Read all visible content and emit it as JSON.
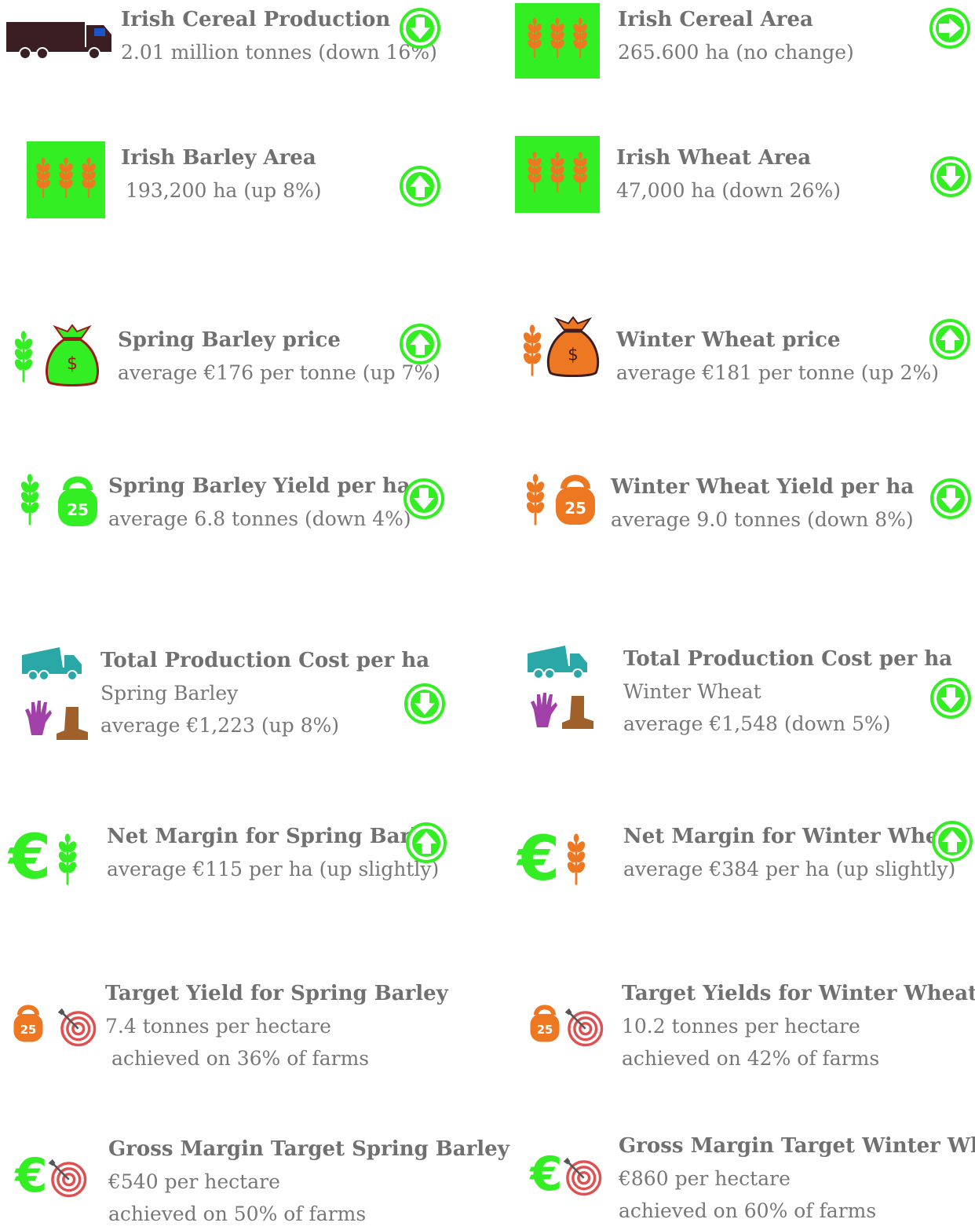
{
  "colors": {
    "green": "#33ee22",
    "orange": "#ee7722",
    "teal": "#2aa8a8",
    "purple": "#a040a8",
    "brown": "#a0602a",
    "truck": "#3a1e22",
    "target_red": "#e05050",
    "text_title": "#707070",
    "text_body": "#777777"
  },
  "items": [
    {
      "title": "Irish Cereal Production",
      "lines": [
        "2.01 million tonnes (down 16%)"
      ],
      "trend": "down",
      "icons": [
        "truck-icon"
      ]
    },
    {
      "title": "Irish Cereal Area",
      "lines": [
        "265.600 ha (no change)"
      ],
      "trend": "right",
      "icons": [
        "wheat-field-icon"
      ]
    },
    {
      "title": "Irish Barley Area",
      "lines": [
        "193,200 ha (up 8%)"
      ],
      "trend": "up",
      "icons": [
        "wheat-field-icon"
      ]
    },
    {
      "title": "Irish Wheat Area",
      "lines": [
        "47,000 ha (down 26%)"
      ],
      "trend": "down",
      "icons": [
        "wheat-field-icon"
      ]
    },
    {
      "title": "Spring Barley price",
      "lines": [
        "average €176 per tonne (up 7%)"
      ],
      "trend": "up",
      "icons": [
        "wheat-stalk-icon",
        "money-bag-icon"
      ]
    },
    {
      "title": "Winter Wheat price",
      "lines": [
        "average €181 per tonne (up 2%)"
      ],
      "trend": "up",
      "icons": [
        "wheat-stalk-icon",
        "money-bag-icon"
      ]
    },
    {
      "title": "Spring Barley Yield per ha",
      "lines": [
        "average 6.8 tonnes (down 4%)"
      ],
      "trend": "down",
      "icons": [
        "wheat-stalk-icon",
        "kettlebell-icon"
      ],
      "kettlebell_label": "25"
    },
    {
      "title": "Winter Wheat Yield per ha",
      "lines": [
        "average 9.0 tonnes (down 8%)"
      ],
      "trend": "down",
      "icons": [
        "wheat-stalk-icon",
        "kettlebell-icon"
      ],
      "kettlebell_label": "25"
    },
    {
      "title": "Total Production Cost per ha",
      "lines": [
        "Spring Barley",
        "average €1,223 (up 8%)"
      ],
      "trend": "down",
      "icons": [
        "dump-truck-icon",
        "glove-icon",
        "boot-icon"
      ]
    },
    {
      "title": "Total Production Cost per ha",
      "lines": [
        "Winter Wheat",
        "average €1,548 (down 5%)"
      ],
      "trend": "down",
      "icons": [
        "dump-truck-icon",
        "glove-icon",
        "boot-icon"
      ]
    },
    {
      "title": "Net Margin for Spring Barley",
      "lines": [
        "average €115 per ha (up slightly)"
      ],
      "trend": "up",
      "icons": [
        "euro-icon",
        "wheat-stalk-icon"
      ],
      "euro_symbol": "€"
    },
    {
      "title": "Net Margin for Winter Wheat",
      "lines": [
        "average €384 per ha (up slightly)"
      ],
      "trend": "up",
      "icons": [
        "euro-icon",
        "wheat-stalk-icon"
      ],
      "euro_symbol": "€"
    },
    {
      "title": "Target Yield for Spring Barley",
      "lines": [
        "7.4 tonnes per hectare",
        " achieved on 36% of farms"
      ],
      "trend": "",
      "icons": [
        "kettlebell-icon",
        "target-icon"
      ],
      "kettlebell_label": "25"
    },
    {
      "title": "Target Yields for Winter Wheat",
      "lines": [
        "10.2 tonnes per hectare",
        "achieved on 42% of farms"
      ],
      "trend": "",
      "icons": [
        "kettlebell-icon",
        "target-icon"
      ],
      "kettlebell_label": "25"
    },
    {
      "title": "Gross Margin Target Spring Barley",
      "lines": [
        "€540 per hectare",
        "achieved on 50% of farms"
      ],
      "trend": "",
      "icons": [
        "euro-icon",
        "target-icon"
      ],
      "euro_symbol": "€"
    },
    {
      "title": "Gross Margin Target Winter Wheat",
      "lines": [
        "€860 per hectare",
        "achieved on 60% of farms"
      ],
      "trend": "",
      "icons": [
        "euro-icon",
        "target-icon"
      ],
      "euro_symbol": "€"
    }
  ]
}
